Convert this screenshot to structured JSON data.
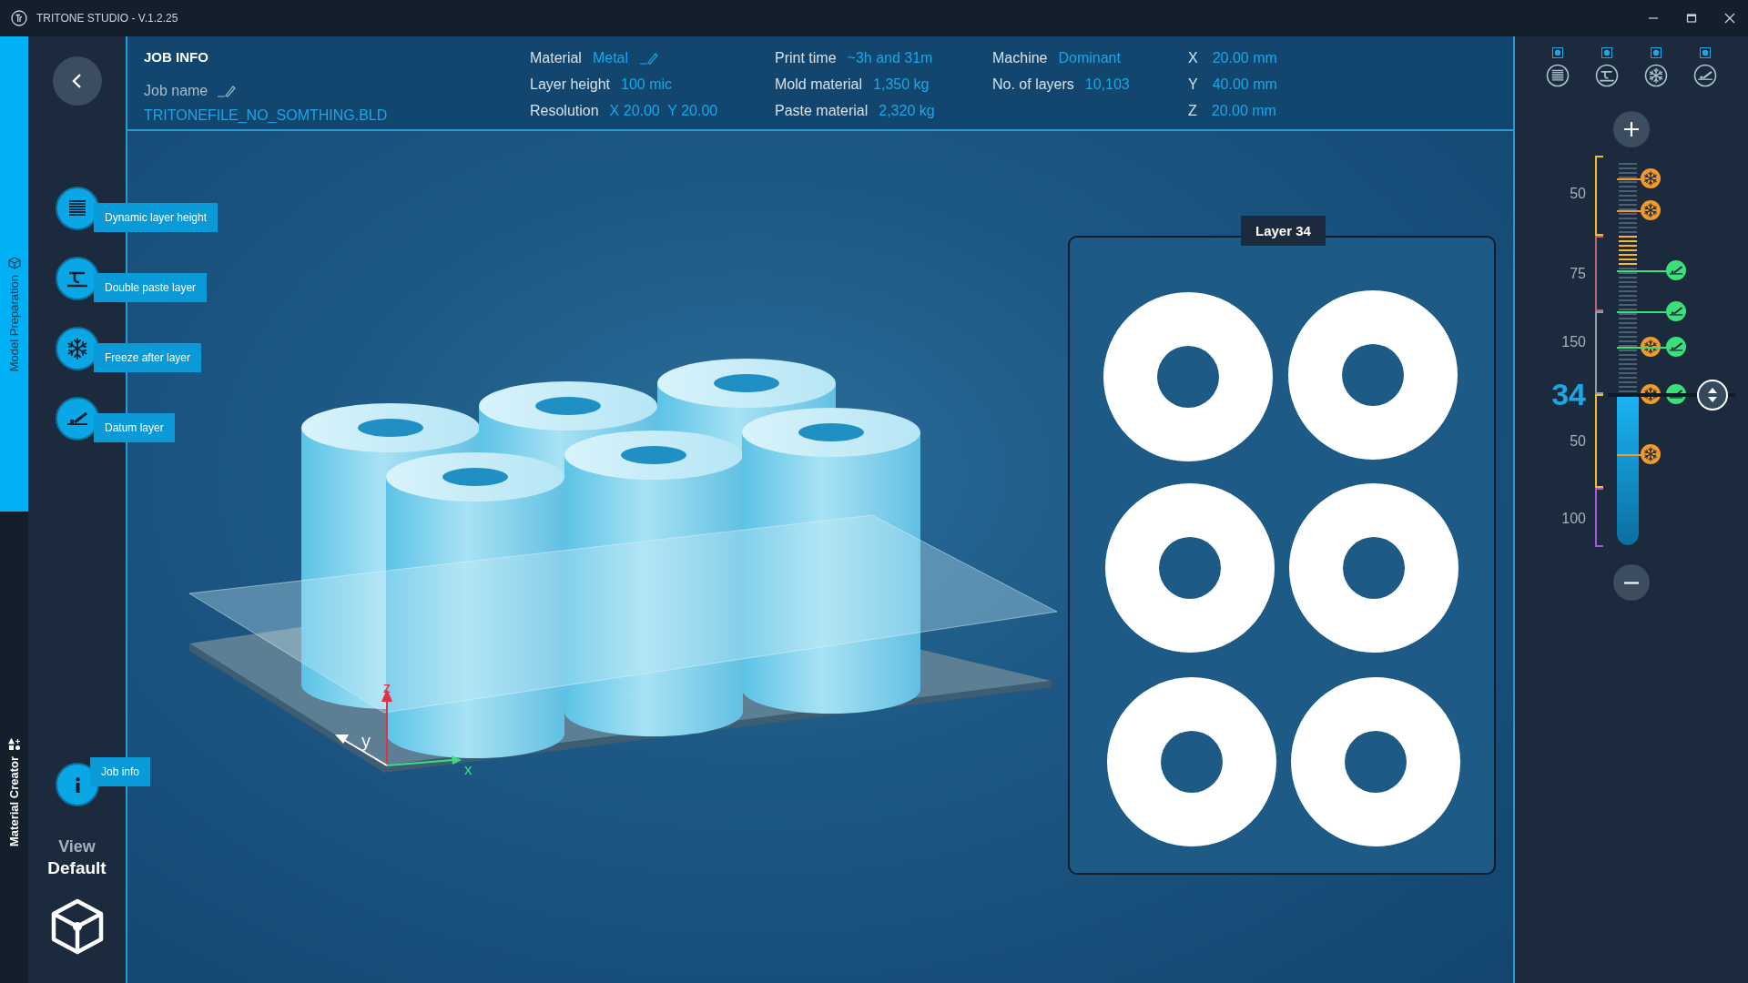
{
  "window": {
    "title": "TRITONE STUDIO - V.1.2.25"
  },
  "nav_tabs": [
    {
      "label": "Model Preparation",
      "selected": true
    },
    {
      "label": "Material Creator",
      "selected": false
    }
  ],
  "job_info": {
    "title": "JOB INFO",
    "job_name_label": "Job name",
    "job_name": "TRITONEFILE_NO_SOMTHING.BLD",
    "columns": [
      [
        {
          "label": "Material",
          "value": "Metal",
          "editable": true
        },
        {
          "label": "Layer height",
          "value": "100 mic",
          "editable": false
        },
        {
          "label": "Resolution",
          "value": "X 20.00  Y 20.00",
          "editable": false
        }
      ],
      [
        {
          "label": "Print time",
          "value": "~3h and 31m",
          "editable": false
        },
        {
          "label": "Mold material",
          "value": "1,350 kg",
          "editable": false
        },
        {
          "label": "Paste material",
          "value": "2,320 kg",
          "editable": false
        }
      ],
      [
        {
          "label": "Machine",
          "value": "Dominant",
          "editable": false
        },
        {
          "label": "No. of layers",
          "value": "10,103",
          "editable": false
        }
      ],
      [
        {
          "label": "X",
          "value": "20.00 mm",
          "editable": false
        },
        {
          "label": "Y",
          "value": "40.00 mm",
          "editable": false
        },
        {
          "label": "Z",
          "value": "20.00 mm",
          "editable": false
        }
      ]
    ]
  },
  "tools": [
    {
      "label": "Dynamic layer height",
      "kind": "layers"
    },
    {
      "label": "Double paste layer",
      "kind": "paste"
    },
    {
      "label": "Freeze after layer",
      "kind": "freeze"
    },
    {
      "label": "Datum layer",
      "kind": "datum"
    }
  ],
  "job_info_button": {
    "label": "Job info"
  },
  "view": {
    "label": "View",
    "value": "Default"
  },
  "axes": {
    "x": "x",
    "y": "y",
    "z": "z"
  },
  "layer_panel": {
    "title": "Layer 34"
  },
  "toggles": [
    {
      "kind": "layers",
      "checked": true
    },
    {
      "kind": "paste",
      "checked": true
    },
    {
      "kind": "freeze",
      "checked": true
    },
    {
      "kind": "datum",
      "checked": true
    }
  ],
  "slider": {
    "level": 0.39,
    "scale": [
      {
        "label": "50",
        "kind": "tick"
      },
      {
        "label": "75",
        "kind": "tick"
      },
      {
        "label": "150",
        "kind": "tick"
      },
      {
        "label": "34",
        "kind": "current"
      },
      {
        "label": "50",
        "kind": "tick"
      },
      {
        "label": "100",
        "kind": "tick"
      }
    ]
  }
}
